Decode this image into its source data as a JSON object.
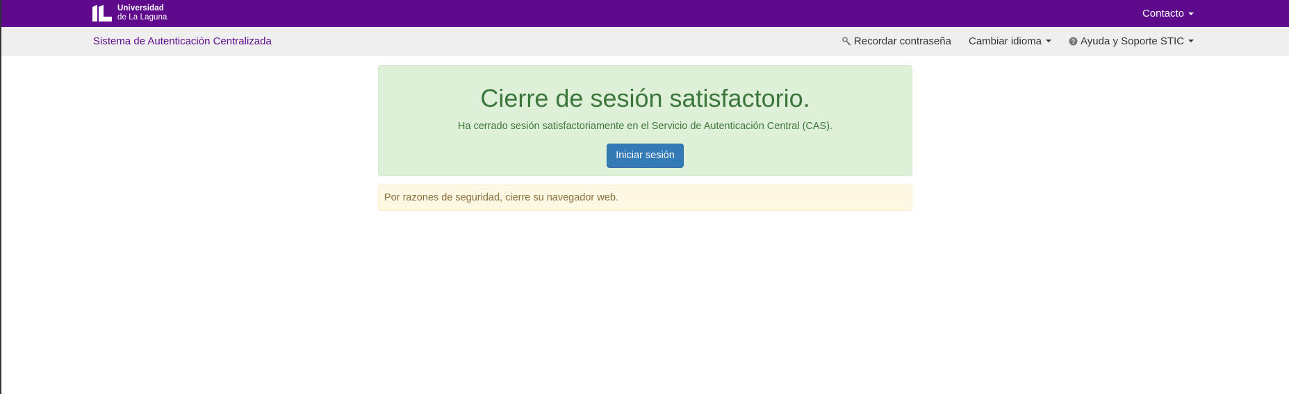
{
  "header": {
    "logo": {
      "line1": "Universidad",
      "line2": "de La Laguna",
      "icon": "ull-logo-icon"
    },
    "contact_label": "Contacto"
  },
  "navbar": {
    "brand": "Sistema de Autenticación Centralizada",
    "items": [
      {
        "label": "Recordar contraseña",
        "icon": "key-icon"
      },
      {
        "label": "Cambiar idioma",
        "icon": "chevron-down-icon"
      },
      {
        "label": "Ayuda y Soporte STIC",
        "icon": "question-circle-icon"
      }
    ]
  },
  "main": {
    "success_title": "Cierre de sesión satisfactorio.",
    "success_text": "Ha cerrado sesión satisfactoriamente en el Servicio de Autenticación Central (CAS).",
    "login_button": "Iniciar sesión",
    "warning_text": "Por razones de seguridad, cierre su navegador web."
  },
  "colors": {
    "brand_purple": "#5f0a8c",
    "navbar_bg": "#efefef",
    "success_bg": "#dff0d8",
    "success_text": "#3c763d",
    "button_blue": "#337ab7",
    "warning_bg": "#fcf8e3",
    "warning_text": "#8a6d3b"
  }
}
